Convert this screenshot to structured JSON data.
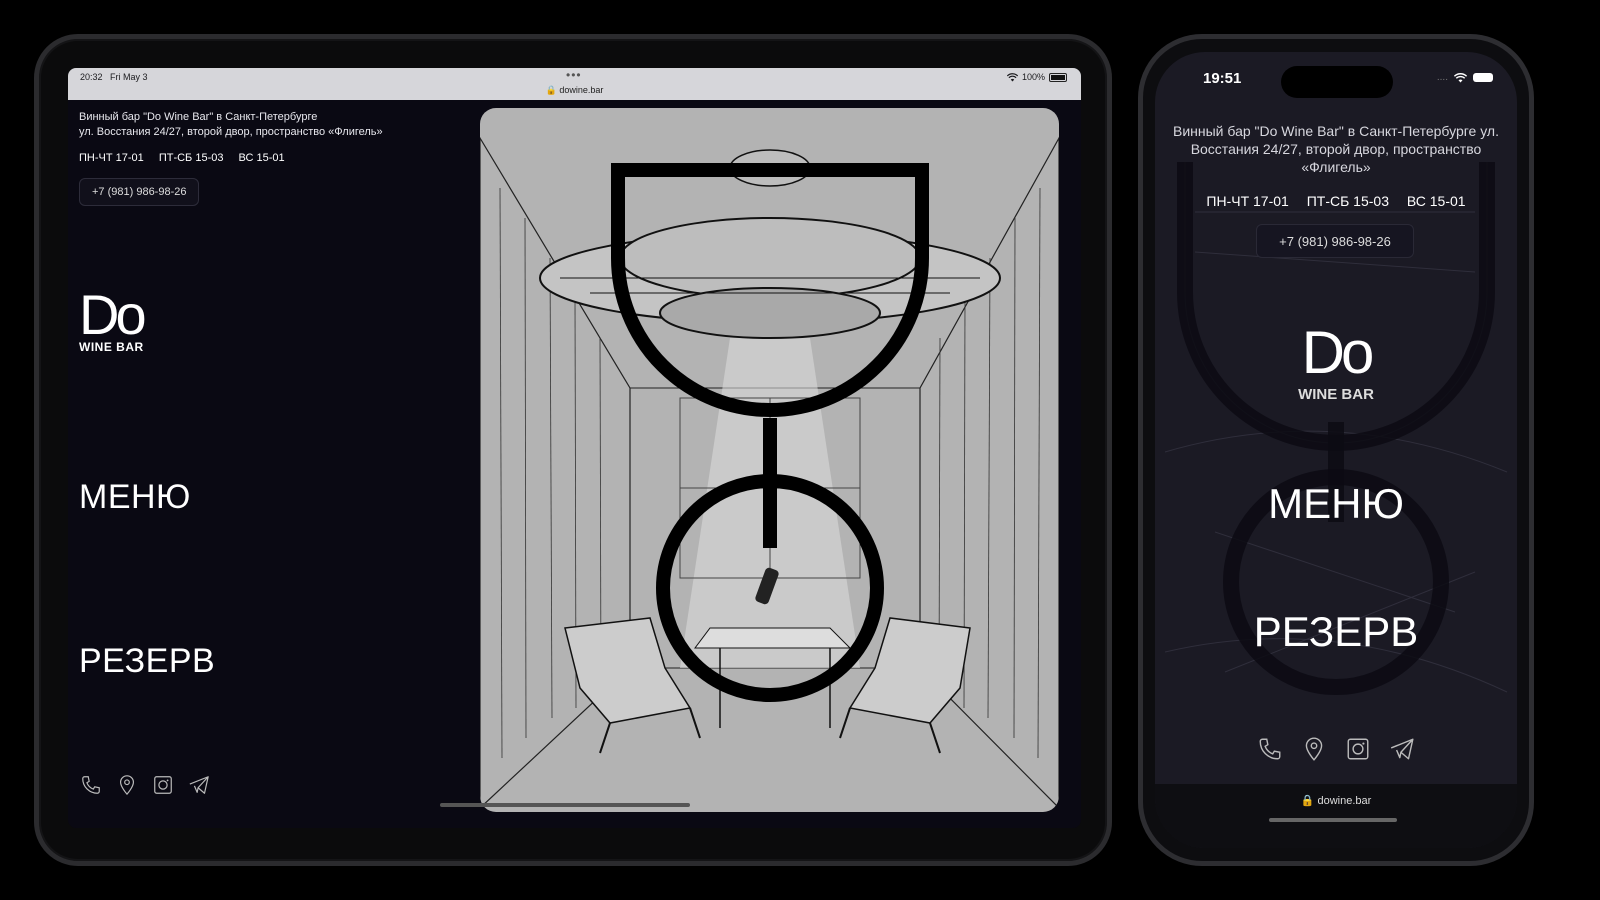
{
  "tablet": {
    "status_time": "20:32",
    "status_date": "Fri May 3",
    "status_dots": "•••",
    "status_battery": "100%",
    "url": "dowine.bar",
    "address_line1": "Винный бар \"Do Wine Bar\" в Санкт-Петербурге",
    "address_line2": "ул. Восстания 24/27, второй двор, пространство «Флигель»",
    "hours": [
      "ПН-ЧТ 17-01",
      "ПТ-СБ 15-03",
      "ВС 15-01"
    ],
    "phone": "+7 (981) 986-98-26",
    "logo_do": "Do",
    "logo_wine": "WINE BAR",
    "menu_link": "МЕНЮ",
    "reserve_link": "РЕЗЕРВ",
    "icons": [
      "phone-icon",
      "location-icon",
      "instagram-icon",
      "telegram-icon"
    ]
  },
  "phone": {
    "status_time": "19:51",
    "status_dots": "....",
    "address": "Винный бар \"Do Wine Bar\" в Санкт-Петербурге ул. Восстания 24/27, второй двор, пространство «Флигель»",
    "hours": [
      "ПН-ЧТ 17-01",
      "ПТ-СБ 15-03",
      "ВС 15-01"
    ],
    "phone": "+7 (981) 986-98-26",
    "logo_do": "Do",
    "logo_wine": "WINE BAR",
    "menu_link": "МЕНЮ",
    "reserve_link": "РЕЗЕРВ",
    "url": "dowine.bar",
    "icons": [
      "phone-icon",
      "location-icon",
      "instagram-icon",
      "telegram-icon"
    ]
  },
  "colors": {
    "page_bg": "#0a0913",
    "art_bg": "#b3b3b3",
    "text": "#ffffff"
  }
}
